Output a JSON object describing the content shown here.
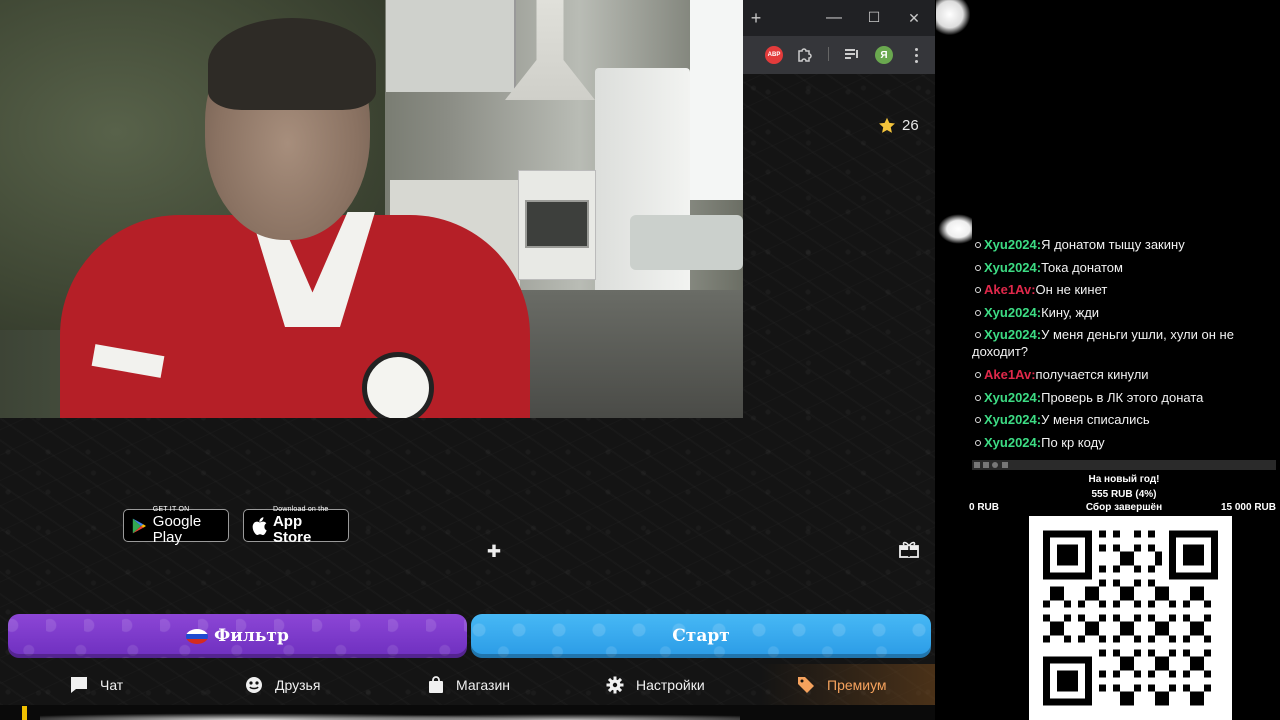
{
  "browser": {
    "new_tab_symbol": "+",
    "minimize_symbol": "—",
    "maximize_symbol": "☐",
    "close_symbol": "✕",
    "abp_label": "ABP",
    "profile_letter": "Я"
  },
  "header": {
    "star_count": "26"
  },
  "stores": {
    "google_small": "GET IT ON",
    "google_big": "Google Play",
    "apple_small": "Download on the",
    "apple_big": "App Store"
  },
  "actions": {
    "filter_label": "Фильтр",
    "start_label": "Старт"
  },
  "nav": {
    "items": [
      {
        "label": "Чат",
        "icon": "chat-icon"
      },
      {
        "label": "Друзья",
        "icon": "friends-icon"
      },
      {
        "label": "Магазин",
        "icon": "shop-bag-icon"
      },
      {
        "label": "Настройки",
        "icon": "gear-icon"
      },
      {
        "label": "Премиум",
        "icon": "tag-icon"
      }
    ],
    "premium_color": "#f5a25d"
  },
  "stream_chat": {
    "messages": [
      {
        "nick": "Xyu2024:",
        "text": "Я донатом тыщу закину",
        "color": "#3ddc84"
      },
      {
        "nick": "Xyu2024:",
        "text": "Тока донатом",
        "color": "#3ddc84"
      },
      {
        "nick": "Ake1Av:",
        "text": "Он не кинет",
        "color": "#e0284a"
      },
      {
        "nick": "Xyu2024:",
        "text": "Кину, жди",
        "color": "#3ddc84"
      },
      {
        "nick": "Xyu2024:",
        "text": "У меня деньги ушли, хули он не доходит?",
        "color": "#3ddc84"
      },
      {
        "nick": "Ake1Av:",
        "text": "получается кинули",
        "color": "#e0284a"
      },
      {
        "nick": "Xyu2024:",
        "text": "Проверь в ЛК этого доната",
        "color": "#3ddc84"
      },
      {
        "nick": "Xyu2024:",
        "text": "У меня списались",
        "color": "#3ddc84"
      },
      {
        "nick": "Xyu2024:",
        "text": "По кр коду",
        "color": "#3ddc84"
      }
    ]
  },
  "donation_goal": {
    "title": "На новый год!",
    "amount": "555 RUB (4%)",
    "min": "0 RUB",
    "status": "Сбор завершён",
    "max": "15 000 RUB",
    "progress": 0.04
  }
}
